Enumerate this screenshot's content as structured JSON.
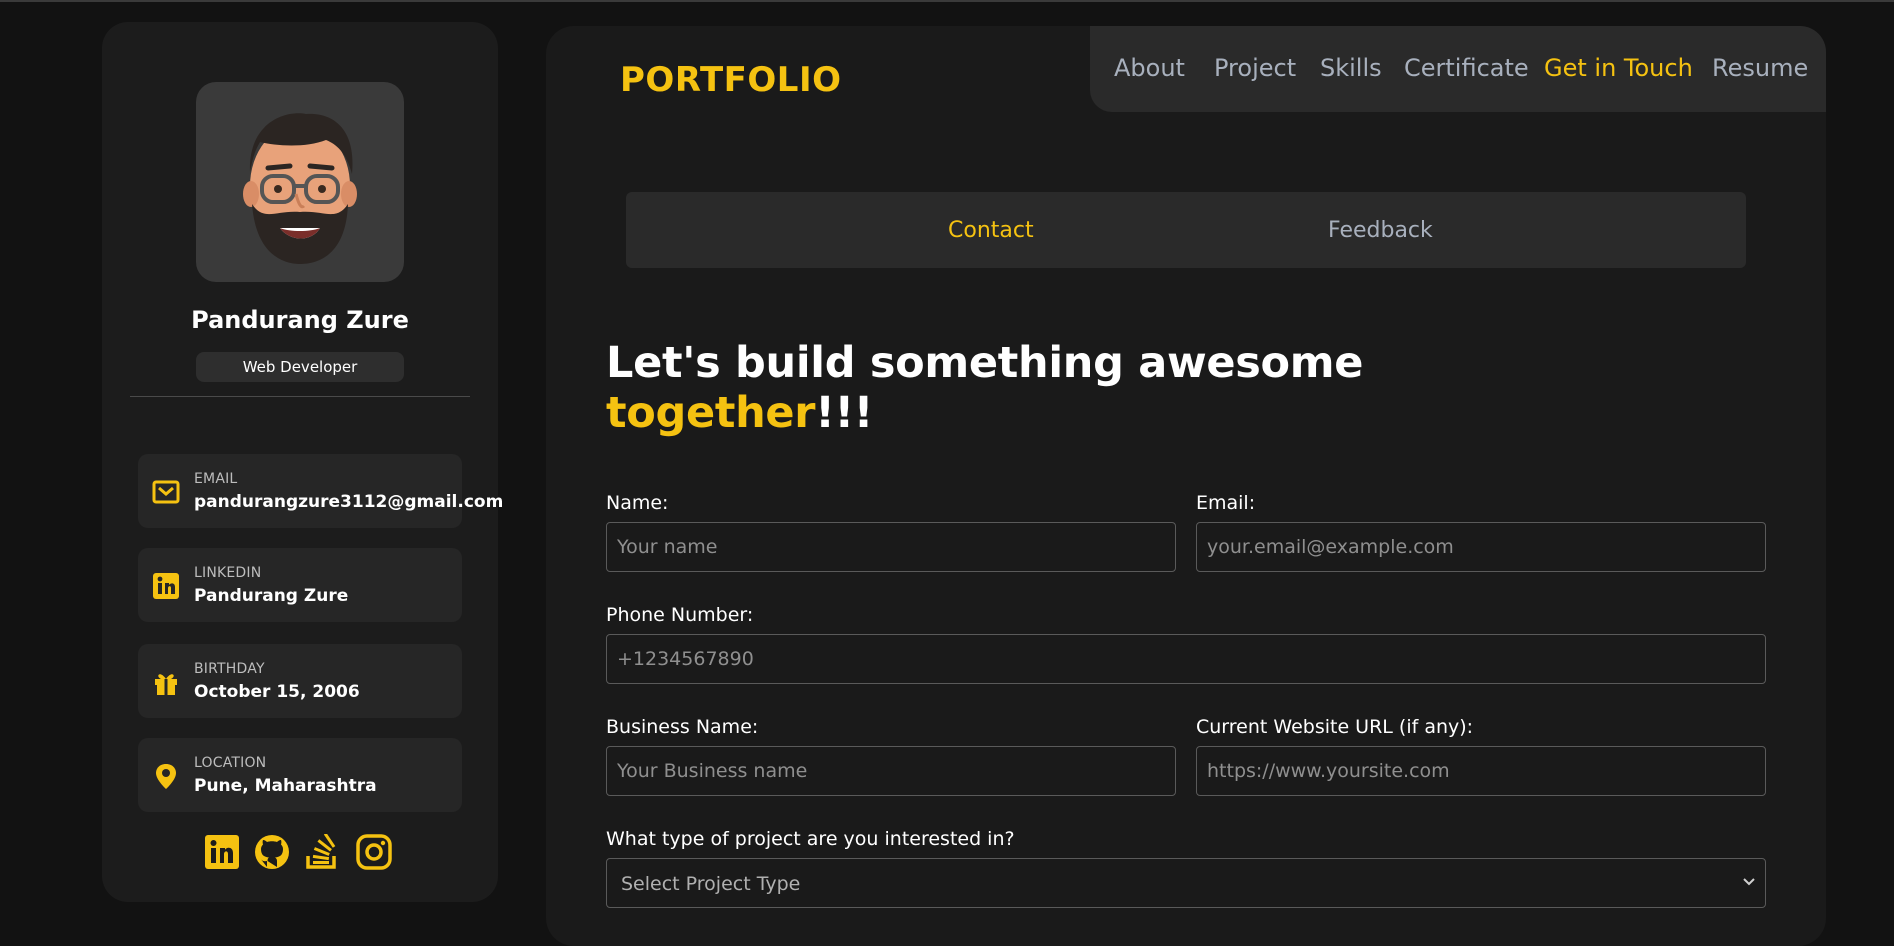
{
  "brand": "PORTFOLIO",
  "nav": [
    {
      "label": "About",
      "active": false
    },
    {
      "label": "Project",
      "active": false
    },
    {
      "label": "Skills",
      "active": false
    },
    {
      "label": "Certificate",
      "active": false
    },
    {
      "label": "Get in Touch",
      "active": true
    },
    {
      "label": "Resume",
      "active": false
    }
  ],
  "profile": {
    "name": "Pandurang Zure",
    "role": "Web Developer",
    "avatar_icon": "memoji-avatar"
  },
  "info": [
    {
      "label": "EMAIL",
      "value": "pandurangzure3112@gmail.com",
      "icon": "mail-icon"
    },
    {
      "label": "LINKEDIN",
      "value": "Pandurang Zure",
      "icon": "linkedin-icon"
    },
    {
      "label": "BIRTHDAY",
      "value": "October 15, 2006",
      "icon": "gift-icon"
    },
    {
      "label": "LOCATION",
      "value": "Pune, Maharashtra",
      "icon": "location-pin-icon"
    }
  ],
  "socials": [
    "linkedin-icon",
    "github-icon",
    "stackoverflow-icon",
    "instagram-icon"
  ],
  "tabs": [
    {
      "label": "Contact",
      "active": true
    },
    {
      "label": "Feedback",
      "active": false
    }
  ],
  "headline": {
    "line1": "Let's build something awesome",
    "accent": "together",
    "suffix": "!!!"
  },
  "form": {
    "name": {
      "label": "Name:",
      "placeholder": "Your name",
      "value": ""
    },
    "email": {
      "label": "Email:",
      "placeholder": "your.email@example.com",
      "value": ""
    },
    "phone": {
      "label": "Phone Number:",
      "placeholder": "+1234567890",
      "value": ""
    },
    "business": {
      "label": "Business Name:",
      "placeholder": "Your Business name",
      "value": ""
    },
    "website": {
      "label": "Current Website URL (if any):",
      "placeholder": "https://www.yoursite.com",
      "value": ""
    },
    "project_type": {
      "label": "What type of project are you interested in?",
      "selected": "Select Project Type"
    }
  },
  "colors": {
    "accent": "#f5c211",
    "background": "#121212",
    "panel": "#1c1c1c",
    "muted_text": "#a8b0bd"
  }
}
